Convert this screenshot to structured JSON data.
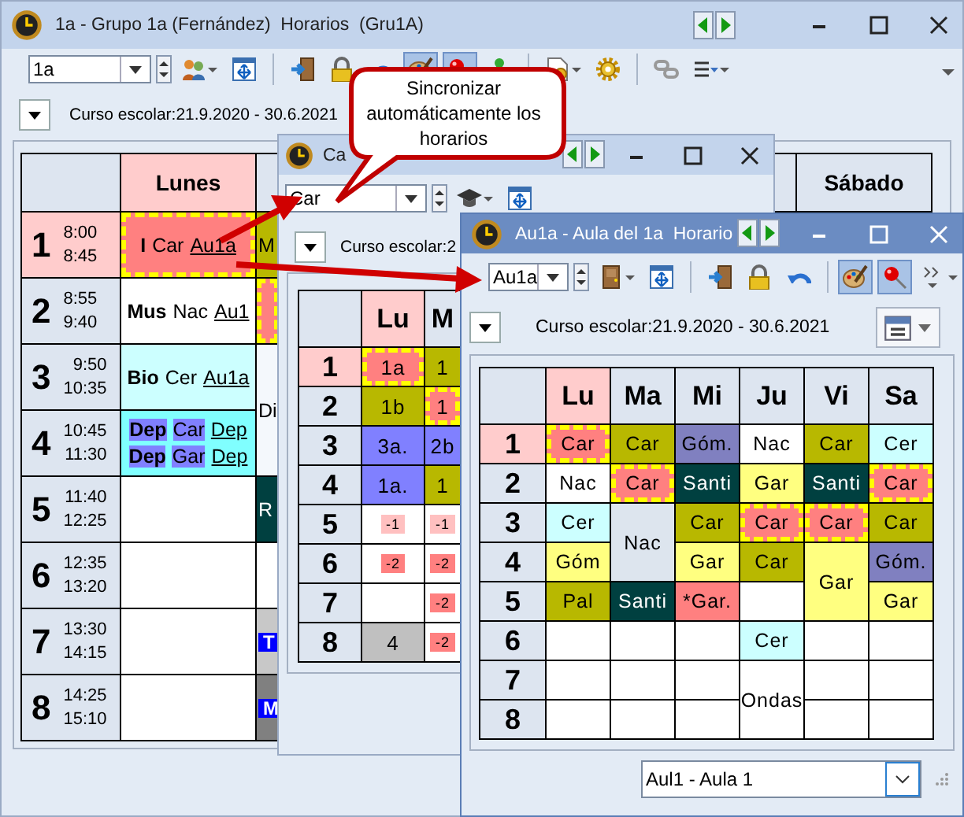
{
  "windows": [
    {
      "title": "1a - Grupo 1a (Fernández)  Horarios  (Gru1A)",
      "active": false,
      "selector": {
        "value": "1a"
      },
      "tools": [
        {
          "kind": "people",
          "menu": true,
          "pressed": false
        },
        {
          "kind": "move",
          "menu": false,
          "pressed": false
        },
        {
          "kind": "separator"
        },
        {
          "kind": "door_arrow",
          "menu": false,
          "pressed": false
        },
        {
          "kind": "lock",
          "menu": false,
          "pressed": false
        },
        {
          "kind": "undo",
          "menu": false,
          "pressed": false
        },
        {
          "kind": "palette",
          "menu": false,
          "pressed": true
        },
        {
          "kind": "pin",
          "menu": false,
          "pressed": true
        },
        {
          "kind": "person",
          "menu": false,
          "pressed": false
        },
        {
          "kind": "separator"
        },
        {
          "kind": "document",
          "menu": true,
          "pressed": false
        },
        {
          "kind": "gear",
          "menu": false,
          "pressed": false
        },
        {
          "kind": "separator"
        },
        {
          "kind": "chain",
          "menu": false,
          "pressed": false
        },
        {
          "kind": "list",
          "menu": true,
          "pressed": false
        },
        {
          "kind": "overflow",
          "menu": false,
          "pressed": false
        }
      ],
      "school_year": "Curso escolar:21.9.2020 - 30.6.2021",
      "timetable": {
        "periods": [
          {
            "number": "1",
            "start": "8:00",
            "end": "8:45",
            "selected": true
          },
          {
            "number": "2",
            "start": "8:55",
            "end": "9:40",
            "selected": false
          },
          {
            "number": "3",
            "start": "9:50",
            "end": "10:35",
            "selected": false
          },
          {
            "number": "4",
            "start": "10:45",
            "end": "11:30",
            "selected": false
          },
          {
            "number": "5",
            "start": "11:40",
            "end": "12:25",
            "selected": false
          },
          {
            "number": "6",
            "start": "12:35",
            "end": "13:20",
            "selected": false
          },
          {
            "number": "7",
            "start": "13:30",
            "end": "14:15",
            "selected": false
          },
          {
            "number": "8",
            "start": "14:25",
            "end": "15:10",
            "selected": false
          }
        ],
        "days": [
          {
            "label": "Lunes",
            "selected": true,
            "cells": [
              {
                "color": "#ff8080",
                "marked": true,
                "lines": [
                  [
                    {
                      "text": "I",
                      "kind": "subject",
                      "highlighted": false
                    },
                    {
                      "text": "Car",
                      "kind": "teacher",
                      "highlighted": false
                    },
                    {
                      "text": "Au1a",
                      "kind": "room",
                      "highlighted": false
                    }
                  ]
                ]
              },
              {
                "color": "#ffffff",
                "marked": false,
                "lines": [
                  [
                    {
                      "text": "Mus",
                      "kind": "subject",
                      "highlighted": false
                    },
                    {
                      "text": "Nac",
                      "kind": "teacher",
                      "highlighted": false
                    },
                    {
                      "text": "Au1",
                      "kind": "room",
                      "highlighted": false
                    }
                  ]
                ]
              },
              {
                "color": "#ccffff",
                "marked": false,
                "lines": [
                  [
                    {
                      "text": "Bio",
                      "kind": "subject",
                      "highlighted": false
                    },
                    {
                      "text": "Cer",
                      "kind": "teacher",
                      "highlighted": false
                    },
                    {
                      "text": "Au1a",
                      "kind": "room",
                      "highlighted": false
                    }
                  ]
                ]
              },
              {
                "color": "#80ffff",
                "marked": false,
                "lines": [
                  [
                    {
                      "text": "Dep",
                      "kind": "subject",
                      "highlighted": true
                    },
                    {
                      "text": "Car",
                      "kind": "teacher",
                      "highlighted": true
                    },
                    {
                      "text": "Dep",
                      "kind": "room",
                      "highlighted": false
                    }
                  ],
                  [
                    {
                      "text": "Dep",
                      "kind": "subject",
                      "highlighted": true
                    },
                    {
                      "text": "Gar",
                      "kind": "teacher",
                      "highlighted": true
                    },
                    {
                      "text": "Dep",
                      "kind": "room",
                      "highlighted": false
                    }
                  ]
                ]
              },
              {
                "color": "#ffffff",
                "marked": false
              },
              {
                "color": "#ffffff",
                "marked": false
              },
              {
                "color": "#ffffff",
                "marked": false
              },
              {
                "color": "#ffffff",
                "marked": false
              }
            ]
          },
          {
            "selected": false,
            "cells": [
              {
                "text": "M",
                "color": "#b8b800",
                "marked": false
              },
              {
                "color": "#ff8080",
                "marked": true
              },
              {
                "text": "Di",
                "color": "#f4f8fc",
                "marked": false,
                "double": true
              },
              {
                "text": "R",
                "color": "#004040",
                "marked": false
              },
              {
                "color": "#ffffff",
                "marked": false
              },
              {
                "color": "#c8c8c8",
                "marked": false,
                "tag": {
                  "text": "T",
                  "color": "#0000ff"
                }
              },
              {
                "color": "#808080",
                "marked": false,
                "tag": {
                  "text": "M",
                  "color": "#0000ff"
                }
              }
            ]
          },
          {
            "label": "Sábado",
            "selected": false
          }
        ]
      }
    },
    {
      "title": "Ca",
      "active": false,
      "selector": {
        "value": "Car"
      },
      "tools": [
        {
          "kind": "cap",
          "menu": true,
          "pressed": false
        },
        {
          "kind": "move",
          "menu": false,
          "pressed": false
        }
      ],
      "school_year": "Curso escolar:2",
      "timetable": {
        "periods": [
          {
            "number": "1",
            "selected": true
          },
          {
            "number": "2",
            "selected": false
          },
          {
            "number": "3",
            "selected": false
          },
          {
            "number": "4",
            "selected": false
          },
          {
            "number": "5",
            "selected": false
          },
          {
            "number": "6",
            "selected": false
          },
          {
            "number": "7",
            "selected": false
          },
          {
            "number": "8",
            "selected": false
          }
        ],
        "days": [
          {
            "label": "Lu",
            "selected": true,
            "cells": [
              {
                "text": "1a",
                "color": "#ff8080",
                "marked": true
              },
              {
                "text": "1b",
                "color": "#b8b800",
                "marked": false
              },
              {
                "text": "3a.",
                "color": "#8080ff",
                "marked": false
              },
              {
                "text": "1a.",
                "color": "#8080ff",
                "marked": false
              },
              {
                "color": "#ffffff",
                "marked": false,
                "tag": {
                  "text": "-1",
                  "color": "#ffc0c0"
                }
              },
              {
                "color": "#ffffff",
                "marked": false,
                "tag": {
                  "text": "-2",
                  "color": "#ff8080"
                }
              },
              {
                "color": "#ffffff",
                "marked": false
              },
              {
                "text": "4",
                "color": "#c0c0c0",
                "marked": false
              }
            ]
          },
          {
            "label": "M",
            "selected": false,
            "cells": [
              {
                "text": "1",
                "color": "#b8b800",
                "marked": false
              },
              {
                "text": "1",
                "color": "#ff8080",
                "marked": true
              },
              {
                "text": "2b",
                "color": "#8080ff",
                "marked": false
              },
              {
                "text": "1",
                "color": "#b8b800",
                "marked": false
              },
              {
                "color": "#ffffff",
                "marked": false,
                "tag": {
                  "text": "-1",
                  "color": "#ffc0c0"
                }
              },
              {
                "color": "#ffffff",
                "marked": false,
                "tag": {
                  "text": "-2",
                  "color": "#ff8080"
                }
              },
              {
                "color": "#ffffff",
                "marked": false,
                "tag": {
                  "text": "-2",
                  "color": "#ff8080"
                }
              },
              {
                "color": "#ffffff",
                "marked": false,
                "tag": {
                  "text": "-2",
                  "color": "#ff8080"
                }
              }
            ]
          }
        ]
      }
    },
    {
      "title": "Au1a - Aula del 1a  Horario",
      "active": true,
      "selector": {
        "value": "Au1a"
      },
      "tools": [
        {
          "kind": "door",
          "menu": true,
          "pressed": false
        },
        {
          "kind": "move",
          "menu": false,
          "pressed": false
        },
        {
          "kind": "separator"
        },
        {
          "kind": "door_arrow",
          "menu": false,
          "pressed": false
        },
        {
          "kind": "lock",
          "menu": false,
          "pressed": false
        },
        {
          "kind": "undo",
          "menu": false,
          "pressed": false
        },
        {
          "kind": "separator"
        },
        {
          "kind": "palette",
          "menu": false,
          "pressed": true
        },
        {
          "kind": "pin",
          "menu": false,
          "pressed": true
        },
        {
          "kind": "more",
          "menu": true,
          "pressed": false
        }
      ],
      "school_year": "Curso escolar:21.9.2020 - 30.6.2021",
      "calendar_button": true,
      "timetable": {
        "periods": [
          {
            "number": "1",
            "selected": true
          },
          {
            "number": "2",
            "selected": false
          },
          {
            "number": "3",
            "selected": false
          },
          {
            "number": "4",
            "selected": false
          },
          {
            "number": "5",
            "selected": false
          },
          {
            "number": "6",
            "selected": false
          },
          {
            "number": "7",
            "selected": false
          },
          {
            "number": "8",
            "selected": false
          }
        ],
        "days": [
          {
            "label": "Lu",
            "selected": true,
            "cells": [
              {
                "text": "Car",
                "color": "#ff8080",
                "marked": true
              },
              {
                "text": "Nac",
                "color": "#ffffff",
                "marked": false
              },
              {
                "text": "Cer",
                "color": "#ccffff",
                "marked": false
              },
              {
                "text": "Góm",
                "color": "#ffff80",
                "marked": false
              },
              {
                "text": "Pal",
                "color": "#b8b800",
                "marked": false
              },
              {
                "color": "#ffffff",
                "marked": false
              },
              {
                "color": "#ffffff",
                "marked": false
              },
              {
                "color": "#ffffff",
                "marked": false
              }
            ]
          },
          {
            "label": "Ma",
            "selected": false,
            "cells": [
              {
                "text": "Car",
                "color": "#b8b800",
                "marked": false
              },
              {
                "text": "Car",
                "color": "#ff8080",
                "marked": true
              },
              {
                "text": "Nac",
                "color": "#dde5ee",
                "marked": false,
                "double": true
              },
              {
                "text": "Santi",
                "color": "#004040",
                "marked": false
              },
              {
                "color": "#ffffff",
                "marked": false
              },
              {
                "color": "#ffffff",
                "marked": false
              },
              {
                "color": "#ffffff",
                "marked": false
              }
            ]
          },
          {
            "label": "Mi",
            "selected": false,
            "cells": [
              {
                "text": "Góm.",
                "color": "#8080c0",
                "marked": false
              },
              {
                "text": "Santi",
                "color": "#004040",
                "marked": false
              },
              {
                "text": "Car",
                "color": "#b8b800",
                "marked": false
              },
              {
                "text": "Gar",
                "color": "#ffff80",
                "marked": false
              },
              {
                "text": "*Gar.",
                "color": "#ff8080",
                "marked": false
              },
              {
                "color": "#ffffff",
                "marked": false
              },
              {
                "color": "#ffffff",
                "marked": false
              },
              {
                "color": "#ffffff",
                "marked": false
              }
            ]
          },
          {
            "label": "Ju",
            "selected": false,
            "cells": [
              {
                "text": "Nac",
                "color": "#ffffff",
                "marked": false
              },
              {
                "text": "Gar",
                "color": "#ffff80",
                "marked": false
              },
              {
                "text": "Car",
                "color": "#ff8080",
                "marked": true
              },
              {
                "text": "Car",
                "color": "#b8b800",
                "marked": false
              },
              {
                "color": "#ffffff",
                "marked": false
              },
              {
                "text": "Cer",
                "color": "#ccffff",
                "marked": false
              },
              {
                "text": "Ondas",
                "color": "#ffffff",
                "marked": false,
                "double": true
              }
            ]
          },
          {
            "label": "Vi",
            "selected": false,
            "cells": [
              {
                "text": "Car",
                "color": "#b8b800",
                "marked": false
              },
              {
                "text": "Santi",
                "color": "#004040",
                "marked": false
              },
              {
                "text": "Car",
                "color": "#ff8080",
                "marked": true
              },
              {
                "text": "Gar",
                "color": "#ffff80",
                "marked": false,
                "double": true
              },
              {
                "color": "#ffffff",
                "marked": false
              },
              {
                "color": "#ffffff",
                "marked": false
              },
              {
                "color": "#ffffff",
                "marked": false
              }
            ]
          },
          {
            "label": "Sa",
            "selected": false,
            "cells": [
              {
                "text": "Cer",
                "color": "#ccffff",
                "marked": false
              },
              {
                "text": "Car",
                "color": "#ff8080",
                "marked": true
              },
              {
                "text": "Car",
                "color": "#b8b800",
                "marked": false
              },
              {
                "text": "Góm.",
                "color": "#8080c0",
                "marked": false
              },
              {
                "text": "Gar",
                "color": "#ffff80",
                "marked": false
              },
              {
                "color": "#ffffff",
                "marked": false
              },
              {
                "color": "#ffffff",
                "marked": false
              },
              {
                "color": "#ffffff",
                "marked": false
              }
            ]
          }
        ]
      },
      "footer_selector": {
        "value": "Aul1 - Aula 1"
      }
    }
  ],
  "callout": {
    "text": "Sincronizar automáticamente los horarios"
  }
}
